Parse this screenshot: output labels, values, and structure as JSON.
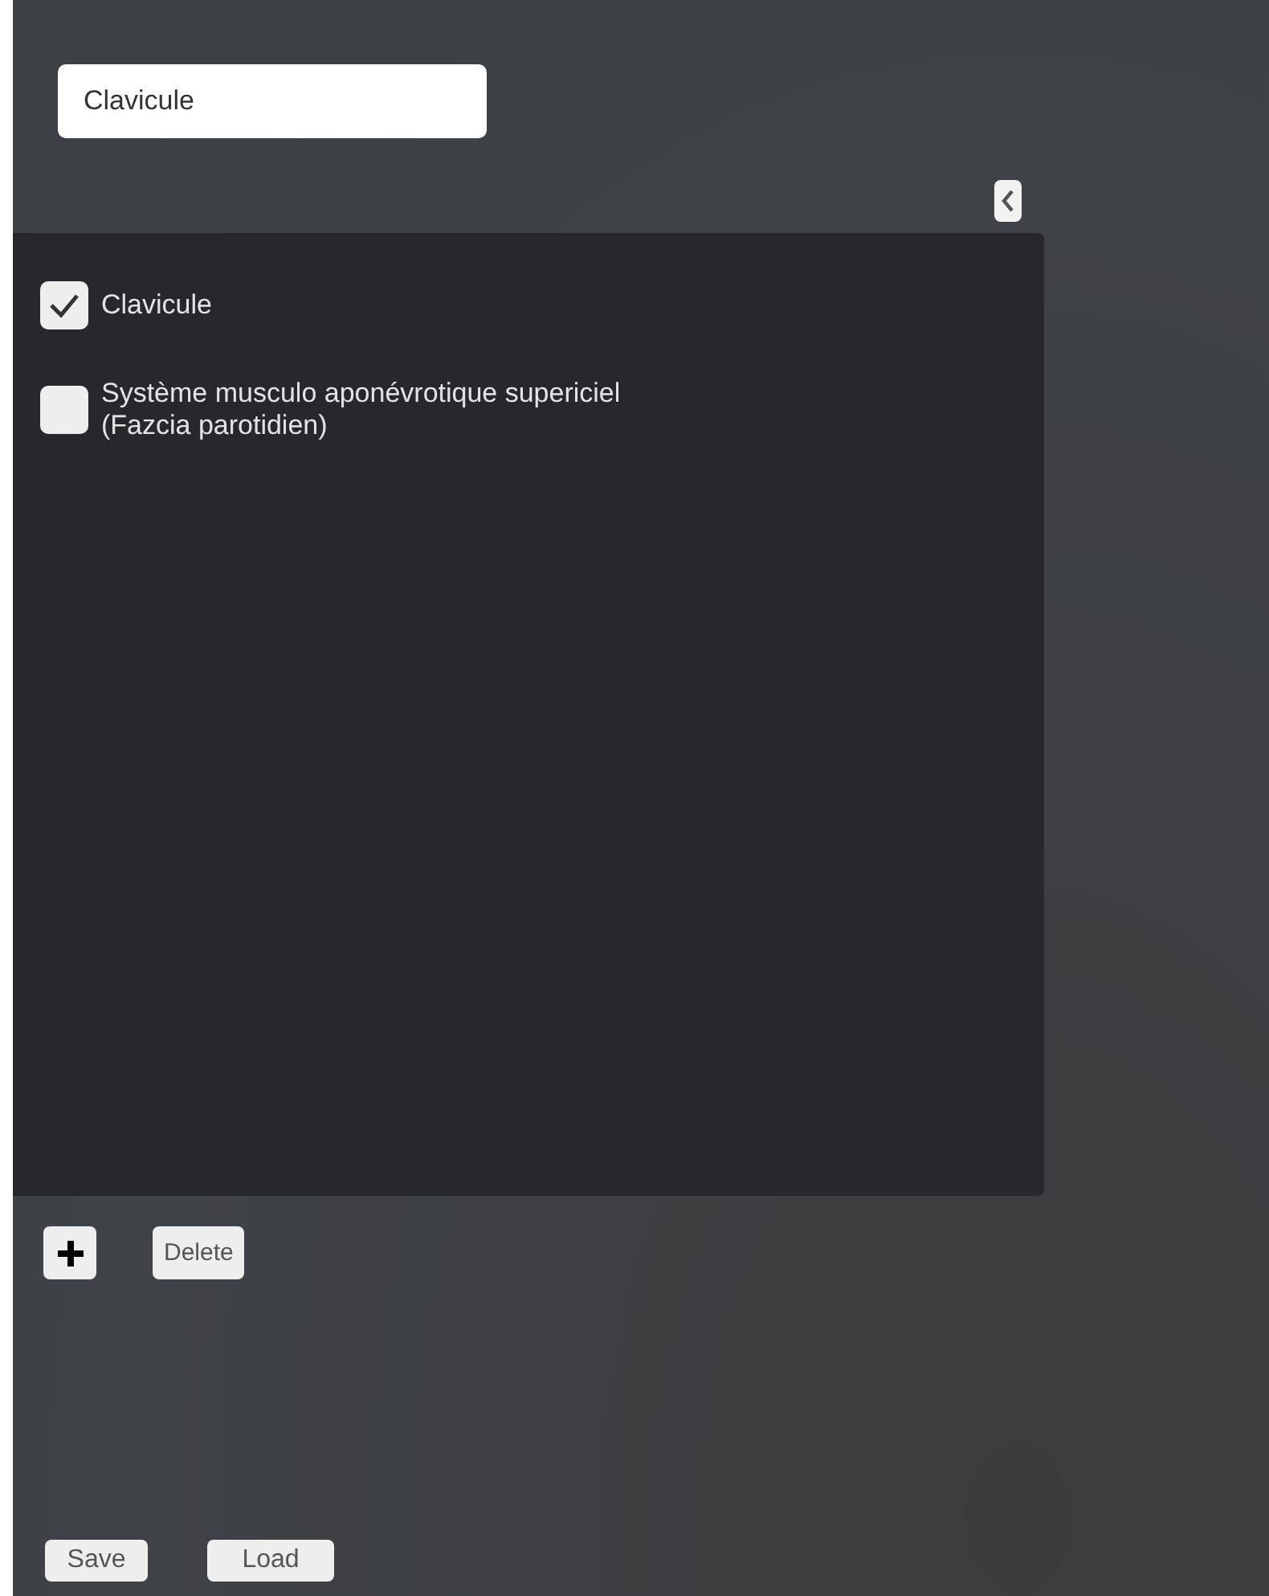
{
  "name_field": {
    "value": "Clavicule"
  },
  "items": [
    {
      "label": "Clavicule",
      "checked": true
    },
    {
      "label": "Système musculo aponévrotique supericiel\n(Fazcia parotidien)",
      "checked": false
    }
  ],
  "list_actions": {
    "delete": "Delete"
  },
  "file_actions": [
    {
      "label": "Save"
    },
    {
      "label": "Load"
    }
  ]
}
